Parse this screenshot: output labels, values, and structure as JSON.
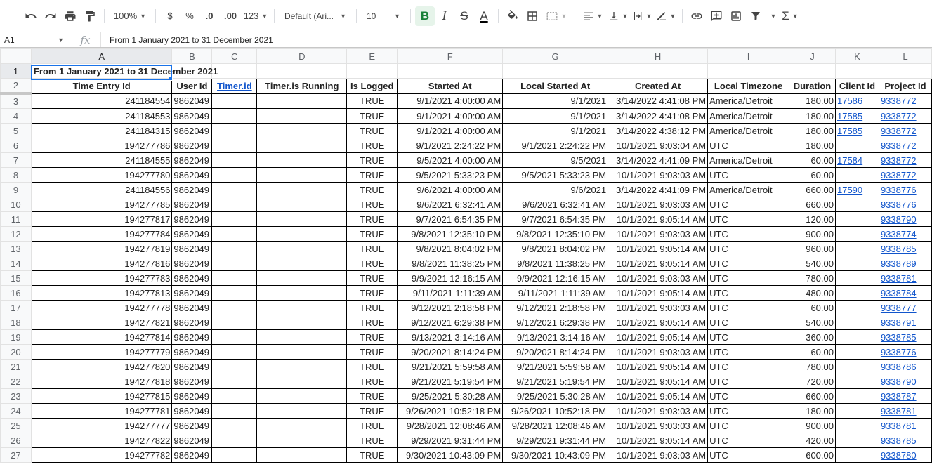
{
  "toolbar": {
    "zoom": "100%",
    "currency": "$",
    "percent": "%",
    "dec_decrease": ".0",
    "dec_increase": ".00",
    "more_formats": "123",
    "font": "Default (Ari...",
    "font_size": "10",
    "bold": "B",
    "italic": "I",
    "strike": "S",
    "text_color": "A"
  },
  "formula_bar": {
    "cell_ref": "A1",
    "fx": "fx",
    "content": "From 1 January 2021 to 31 December 2021"
  },
  "columns": [
    "A",
    "B",
    "C",
    "D",
    "E",
    "F",
    "G",
    "H",
    "I",
    "J",
    "K",
    "L"
  ],
  "title": "From 1 January 2021 to 31 December 2021",
  "headers": [
    "Time Entry Id",
    "User Id",
    "Timer.id",
    "Timer.is Running",
    "Is Logged",
    "Started At",
    "Local Started At",
    "Created At",
    "Local Timezone",
    "Duration",
    "Client Id",
    "Project Id"
  ],
  "rows": [
    [
      "241184554",
      "9862049",
      "",
      "",
      "TRUE",
      "9/1/2021 4:00:00 AM",
      "9/1/2021",
      "3/14/2022 4:41:08 PM",
      "America/Detroit",
      "180.00",
      "17586",
      "9338772"
    ],
    [
      "241184553",
      "9862049",
      "",
      "",
      "TRUE",
      "9/1/2021 4:00:00 AM",
      "9/1/2021",
      "3/14/2022 4:41:08 PM",
      "America/Detroit",
      "180.00",
      "17585",
      "9338772"
    ],
    [
      "241184315",
      "9862049",
      "",
      "",
      "TRUE",
      "9/1/2021 4:00:00 AM",
      "9/1/2021",
      "3/14/2022 4:38:12 PM",
      "America/Detroit",
      "180.00",
      "17585",
      "9338772"
    ],
    [
      "194277786",
      "9862049",
      "",
      "",
      "TRUE",
      "9/1/2021 2:24:22 PM",
      "9/1/2021 2:24:22 PM",
      "10/1/2021 9:03:04 AM",
      "UTC",
      "180.00",
      "",
      "9338772"
    ],
    [
      "241184555",
      "9862049",
      "",
      "",
      "TRUE",
      "9/5/2021 4:00:00 AM",
      "9/5/2021",
      "3/14/2022 4:41:09 PM",
      "America/Detroit",
      "60.00",
      "17584",
      "9338772"
    ],
    [
      "194277780",
      "9862049",
      "",
      "",
      "TRUE",
      "9/5/2021 5:33:23 PM",
      "9/5/2021 5:33:23 PM",
      "10/1/2021 9:03:03 AM",
      "UTC",
      "60.00",
      "",
      "9338772"
    ],
    [
      "241184556",
      "9862049",
      "",
      "",
      "TRUE",
      "9/6/2021 4:00:00 AM",
      "9/6/2021",
      "3/14/2022 4:41:09 PM",
      "America/Detroit",
      "660.00",
      "17590",
      "9338776"
    ],
    [
      "194277785",
      "9862049",
      "",
      "",
      "TRUE",
      "9/6/2021 6:32:41 AM",
      "9/6/2021 6:32:41 AM",
      "10/1/2021 9:03:03 AM",
      "UTC",
      "660.00",
      "",
      "9338776"
    ],
    [
      "194277817",
      "9862049",
      "",
      "",
      "TRUE",
      "9/7/2021 6:54:35 PM",
      "9/7/2021 6:54:35 PM",
      "10/1/2021 9:05:14 AM",
      "UTC",
      "120.00",
      "",
      "9338790"
    ],
    [
      "194277784",
      "9862049",
      "",
      "",
      "TRUE",
      "9/8/2021 12:35:10 PM",
      "9/8/2021 12:35:10 PM",
      "10/1/2021 9:03:03 AM",
      "UTC",
      "900.00",
      "",
      "9338774"
    ],
    [
      "194277819",
      "9862049",
      "",
      "",
      "TRUE",
      "9/8/2021 8:04:02 PM",
      "9/8/2021 8:04:02 PM",
      "10/1/2021 9:05:14 AM",
      "UTC",
      "960.00",
      "",
      "9338785"
    ],
    [
      "194277816",
      "9862049",
      "",
      "",
      "TRUE",
      "9/8/2021 11:38:25 PM",
      "9/8/2021 11:38:25 PM",
      "10/1/2021 9:05:14 AM",
      "UTC",
      "540.00",
      "",
      "9338789"
    ],
    [
      "194277783",
      "9862049",
      "",
      "",
      "TRUE",
      "9/9/2021 12:16:15 AM",
      "9/9/2021 12:16:15 AM",
      "10/1/2021 9:03:03 AM",
      "UTC",
      "780.00",
      "",
      "9338781"
    ],
    [
      "194277813",
      "9862049",
      "",
      "",
      "TRUE",
      "9/11/2021 1:11:39 AM",
      "9/11/2021 1:11:39 AM",
      "10/1/2021 9:05:14 AM",
      "UTC",
      "480.00",
      "",
      "9338784"
    ],
    [
      "194277778",
      "9862049",
      "",
      "",
      "TRUE",
      "9/12/2021 2:18:58 PM",
      "9/12/2021 2:18:58 PM",
      "10/1/2021 9:03:03 AM",
      "UTC",
      "60.00",
      "",
      "9338777"
    ],
    [
      "194277821",
      "9862049",
      "",
      "",
      "TRUE",
      "9/12/2021 6:29:38 PM",
      "9/12/2021 6:29:38 PM",
      "10/1/2021 9:05:14 AM",
      "UTC",
      "540.00",
      "",
      "9338791"
    ],
    [
      "194277814",
      "9862049",
      "",
      "",
      "TRUE",
      "9/13/2021 3:14:16 AM",
      "9/13/2021 3:14:16 AM",
      "10/1/2021 9:05:14 AM",
      "UTC",
      "360.00",
      "",
      "9338785"
    ],
    [
      "194277779",
      "9862049",
      "",
      "",
      "TRUE",
      "9/20/2021 8:14:24 PM",
      "9/20/2021 8:14:24 PM",
      "10/1/2021 9:03:03 AM",
      "UTC",
      "60.00",
      "",
      "9338776"
    ],
    [
      "194277820",
      "9862049",
      "",
      "",
      "TRUE",
      "9/21/2021 5:59:58 AM",
      "9/21/2021 5:59:58 AM",
      "10/1/2021 9:05:14 AM",
      "UTC",
      "780.00",
      "",
      "9338786"
    ],
    [
      "194277818",
      "9862049",
      "",
      "",
      "TRUE",
      "9/21/2021 5:19:54 PM",
      "9/21/2021 5:19:54 PM",
      "10/1/2021 9:05:14 AM",
      "UTC",
      "720.00",
      "",
      "9338790"
    ],
    [
      "194277815",
      "9862049",
      "",
      "",
      "TRUE",
      "9/25/2021 5:30:28 AM",
      "9/25/2021 5:30:28 AM",
      "10/1/2021 9:05:14 AM",
      "UTC",
      "660.00",
      "",
      "9338787"
    ],
    [
      "194277781",
      "9862049",
      "",
      "",
      "TRUE",
      "9/26/2021 10:52:18 PM",
      "9/26/2021 10:52:18 PM",
      "10/1/2021 9:03:03 AM",
      "UTC",
      "180.00",
      "",
      "9338781"
    ],
    [
      "194277777",
      "9862049",
      "",
      "",
      "TRUE",
      "9/28/2021 12:08:46 AM",
      "9/28/2021 12:08:46 AM",
      "10/1/2021 9:03:03 AM",
      "UTC",
      "900.00",
      "",
      "9338781"
    ],
    [
      "194277822",
      "9862049",
      "",
      "",
      "TRUE",
      "9/29/2021 9:31:44 PM",
      "9/29/2021 9:31:44 PM",
      "10/1/2021 9:05:14 AM",
      "UTC",
      "420.00",
      "",
      "9338785"
    ],
    [
      "194277782",
      "9862049",
      "",
      "",
      "TRUE",
      "9/30/2021 10:43:09 PM",
      "9/30/2021 10:43:09 PM",
      "10/1/2021 9:03:03 AM",
      "UTC",
      "600.00",
      "",
      "9338780"
    ]
  ],
  "colors": {
    "link": "#1155cc",
    "selection": "#1a73e8",
    "header_bg": "#f8f9fa"
  }
}
